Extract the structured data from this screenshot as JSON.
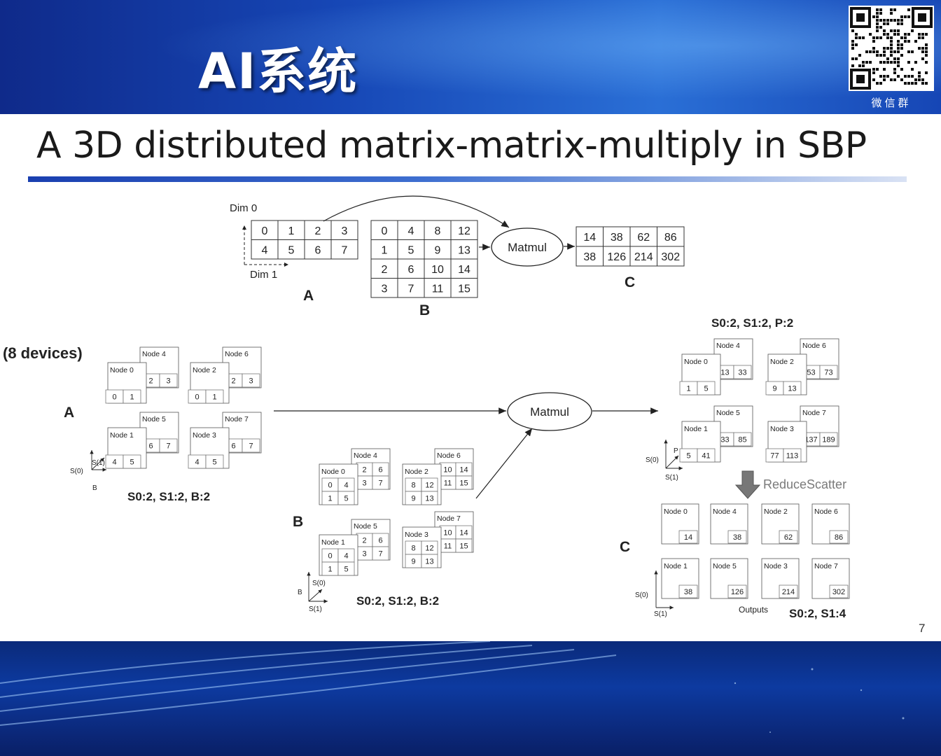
{
  "header": {
    "logo_title": "AI系统",
    "qr_label": "微信群"
  },
  "slide": {
    "title": "A 3D distributed matrix-matrix-multiply in SBP",
    "page_number": "7"
  },
  "top_diagram": {
    "dim0_label": "Dim 0",
    "dim1_label": "Dim 1",
    "matrix_a": [
      [
        "0",
        "1",
        "2",
        "3"
      ],
      [
        "4",
        "5",
        "6",
        "7"
      ]
    ],
    "matrix_b": [
      [
        "0",
        "4",
        "8",
        "12"
      ],
      [
        "1",
        "5",
        "9",
        "13"
      ],
      [
        "2",
        "6",
        "10",
        "14"
      ],
      [
        "3",
        "7",
        "11",
        "15"
      ]
    ],
    "matrix_c": [
      [
        "14",
        "38",
        "62",
        "86"
      ],
      [
        "38",
        "126",
        "214",
        "302"
      ]
    ],
    "label_a": "A",
    "label_b": "B",
    "label_c": "C",
    "op_label": "Matmul"
  },
  "bottom_diagram": {
    "devices_label": "(8 devices)",
    "label_a": "A",
    "label_b": "B",
    "label_c": "C",
    "op_label": "Matmul",
    "a_sbp": "S0:2, S1:2, B:2",
    "b_sbp": "S0:2, S1:2, B:2",
    "c_partial_sbp": "S0:2, S1:2, P:2",
    "c_final_sbp": "S0:2, S1:4",
    "reduce_label": "ReduceScatter",
    "outputs_label": "Outputs",
    "axis_s0": "S(0)",
    "axis_s1": "S(1)",
    "axis_b": "B",
    "axis_p": "P",
    "a_groups": [
      {
        "back": "Node 4",
        "front": "Node 0",
        "back_vals": [
          "2",
          "3"
        ],
        "front_vals": [
          "0",
          "1"
        ]
      },
      {
        "back": "Node 6",
        "front": "Node 2",
        "back_vals": [
          "2",
          "3"
        ],
        "front_vals": [
          "0",
          "1"
        ]
      },
      {
        "back": "Node 5",
        "front": "Node 1",
        "back_vals": [
          "6",
          "7"
        ],
        "front_vals": [
          "4",
          "5"
        ]
      },
      {
        "back": "Node 7",
        "front": "Node 3",
        "back_vals": [
          "6",
          "7"
        ],
        "front_vals": [
          "4",
          "5"
        ]
      }
    ],
    "b_groups": [
      {
        "back": "Node 4",
        "front": "Node 0",
        "back_vals": [
          "2",
          "6",
          "3",
          "7"
        ],
        "front_vals": [
          "0",
          "4",
          "1",
          "5"
        ]
      },
      {
        "back": "Node 6",
        "front": "Node 2",
        "back_vals": [
          "10",
          "14",
          "11",
          "15"
        ],
        "front_vals": [
          "8",
          "12",
          "9",
          "13"
        ]
      },
      {
        "back": "Node 5",
        "front": "Node 1",
        "back_vals": [
          "2",
          "6",
          "3",
          "7"
        ],
        "front_vals": [
          "0",
          "4",
          "1",
          "5"
        ]
      },
      {
        "back": "Node 7",
        "front": "Node 3",
        "back_vals": [
          "10",
          "14",
          "11",
          "15"
        ],
        "front_vals": [
          "8",
          "12",
          "9",
          "13"
        ]
      }
    ],
    "c_partial_groups": [
      {
        "back": "Node 4",
        "front": "Node 0",
        "back_vals": [
          "13",
          "33"
        ],
        "front_vals": [
          "1",
          "5"
        ]
      },
      {
        "back": "Node 6",
        "front": "Node 2",
        "back_vals": [
          "53",
          "73"
        ],
        "front_vals": [
          "9",
          "13"
        ]
      },
      {
        "back": "Node 5",
        "front": "Node 1",
        "back_vals": [
          "33",
          "85"
        ],
        "front_vals": [
          "5",
          "41"
        ]
      },
      {
        "back": "Node 7",
        "front": "Node 3",
        "back_vals": [
          "137",
          "189"
        ],
        "front_vals": [
          "77",
          "113"
        ]
      }
    ],
    "c_outputs": [
      {
        "node": "Node 0",
        "val": "14"
      },
      {
        "node": "Node 4",
        "val": "38"
      },
      {
        "node": "Node 2",
        "val": "62"
      },
      {
        "node": "Node 6",
        "val": "86"
      },
      {
        "node": "Node 1",
        "val": "38"
      },
      {
        "node": "Node 5",
        "val": "126"
      },
      {
        "node": "Node 3",
        "val": "214"
      },
      {
        "node": "Node 7",
        "val": "302"
      }
    ]
  }
}
